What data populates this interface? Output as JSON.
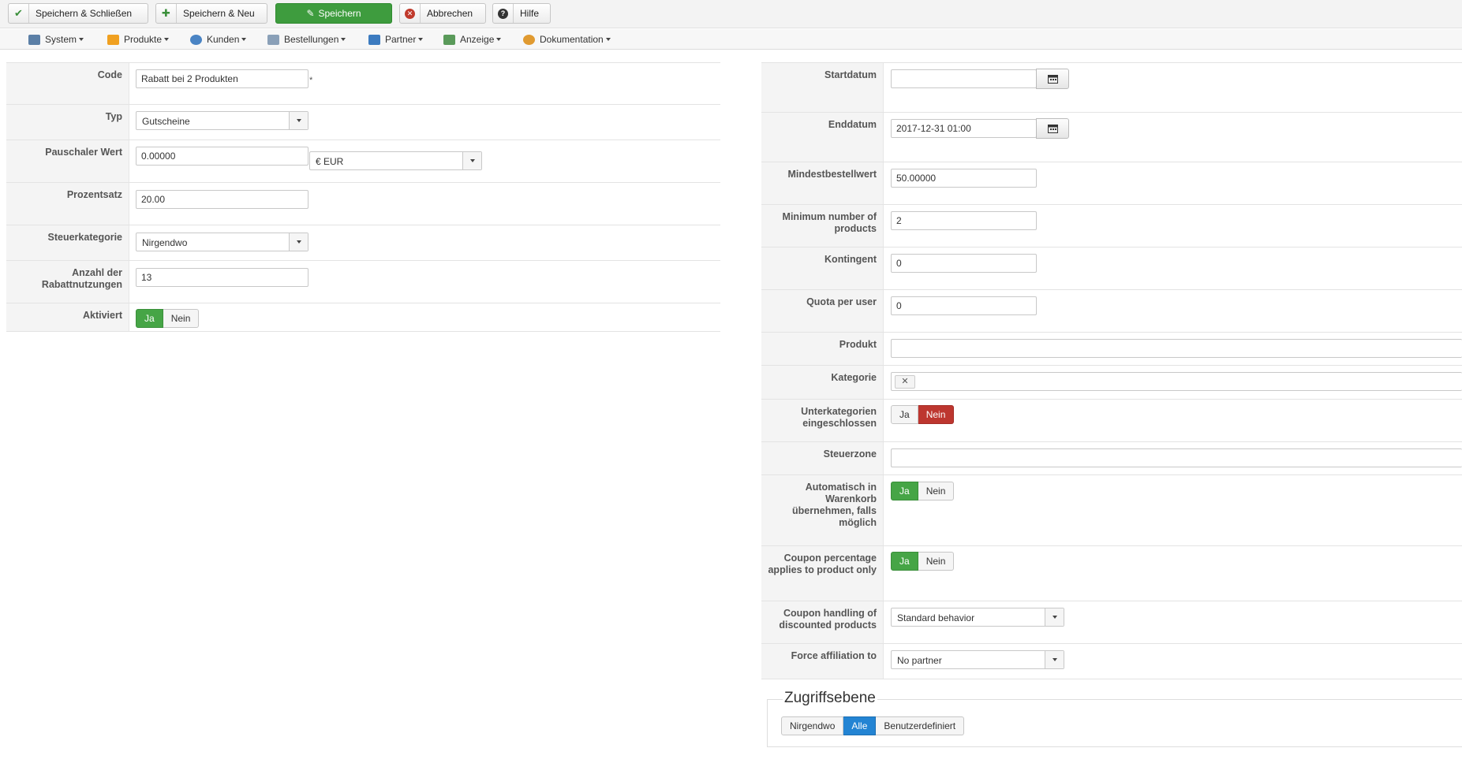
{
  "toolbar": {
    "save_close": "Speichern & Schließen",
    "save_new": "Speichern & Neu",
    "save": "Speichern",
    "cancel": "Abbrechen",
    "help": "Hilfe"
  },
  "menu": [
    {
      "label": "System",
      "icon": "wrench-icon",
      "color": "#5b7fa6"
    },
    {
      "label": "Produkte",
      "icon": "box-icon",
      "color": "#f0a020"
    },
    {
      "label": "Kunden",
      "icon": "users-icon",
      "color": "#4a84c4"
    },
    {
      "label": "Bestellungen",
      "icon": "orders-icon",
      "color": "#8aa0b8"
    },
    {
      "label": "Partner",
      "icon": "partner-icon",
      "color": "#3c7bc0"
    },
    {
      "label": "Anzeige",
      "icon": "display-icon",
      "color": "#5a9a5a"
    },
    {
      "label": "Dokumentation",
      "icon": "docs-icon",
      "color": "#e09a30"
    }
  ],
  "left": {
    "code_label": "Code",
    "code_value": "Rabatt bei 2 Produkten",
    "code_required": "*",
    "type_label": "Typ",
    "type_value": "Gutscheine",
    "flat_label": "Pauschaler Wert",
    "flat_value": "0.00000",
    "currency_value": "€ EUR",
    "percent_label": "Prozentsatz",
    "percent_value": "20.00",
    "tax_label": "Steuerkategorie",
    "tax_value": "Nirgendwo",
    "uses_label": "Anzahl der Rabattnutzungen",
    "uses_value": "13",
    "active_label": "Aktiviert",
    "yes": "Ja",
    "no": "Nein"
  },
  "right": {
    "start_label": "Startdatum",
    "start_value": "",
    "end_label": "Enddatum",
    "end_value": "2017-12-31 01:00",
    "min_order_label": "Mindestbestellwert",
    "min_order_value": "50.00000",
    "min_products_label": "Minimum number of products",
    "min_products_value": "2",
    "quota_label": "Kontingent",
    "quota_value": "0",
    "quota_user_label": "Quota per user",
    "quota_user_value": "0",
    "product_label": "Produkt",
    "category_label": "Kategorie",
    "subcat_label": "Unterkategorien eingeschlossen",
    "taxzone_label": "Steuerzone",
    "autocart_label": "Automatisch in Warenkorb übernehmen, falls möglich",
    "coupon_pct_label": "Coupon percentage applies to product only",
    "coupon_handling_label": "Coupon handling of discounted products",
    "coupon_handling_value": "Standard behavior",
    "force_aff_label": "Force affiliation to",
    "force_aff_value": "No partner",
    "yes": "Ja",
    "no": "Nein"
  },
  "access": {
    "legend": "Zugriffsebene",
    "options": [
      "Nirgendwo",
      "Alle",
      "Benutzerdefiniert"
    ],
    "selected": "Alle"
  },
  "colors": {
    "green": "#46a546",
    "red": "#bd362f",
    "blue": "#2384d3"
  }
}
